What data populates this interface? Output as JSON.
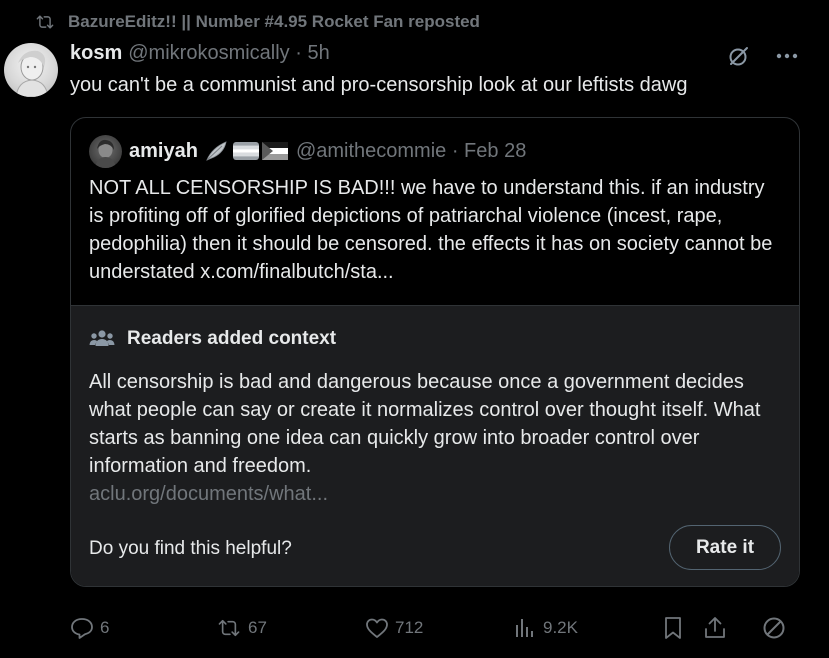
{
  "repost": {
    "icon": "repost-icon",
    "text": "BazureEditz!! || Number #4.95 Rocket Fan reposted"
  },
  "post": {
    "author_name": "kosm",
    "author_meta": "@mikrokosmically · 5h",
    "text": "you can't be a communist and pro-censorship look at our leftists dawg"
  },
  "header_icons": [
    "grok-icon",
    "more-icon"
  ],
  "quote": {
    "name": "amiyah",
    "flags": [
      "feather-emoji",
      "trans-flag-emoji",
      "palestine-flag-emoji"
    ],
    "meta": "@amithecommie · Feb 28",
    "text": "NOT ALL CENSORSHIP IS BAD!!! we have to understand this. if an industry is profiting off of glorified depictions of patriarchal violence (incest, rape, pedophilia) then it should be censored. the effects it has on society cannot be understated x.com/finalbutch/sta..."
  },
  "community_note": {
    "title": "Readers added context",
    "body": "All censorship is bad and dangerous because once a government decides what people can say or create it normalizes control over thought itself. What starts as banning one idea can quickly grow into broader control over information and freedom.",
    "link": "aclu.org/documents/what...",
    "helpful_question": "Do you find this helpful?",
    "rate_label": "Rate it"
  },
  "actions": {
    "replies": "6",
    "reposts": "67",
    "likes": "712",
    "views": "9.2K"
  },
  "colors": {
    "background": "#000000",
    "text": "#e7e9ea",
    "muted": "#71767b",
    "border": "#2f3336",
    "note_bg": "#1c1d1f"
  }
}
